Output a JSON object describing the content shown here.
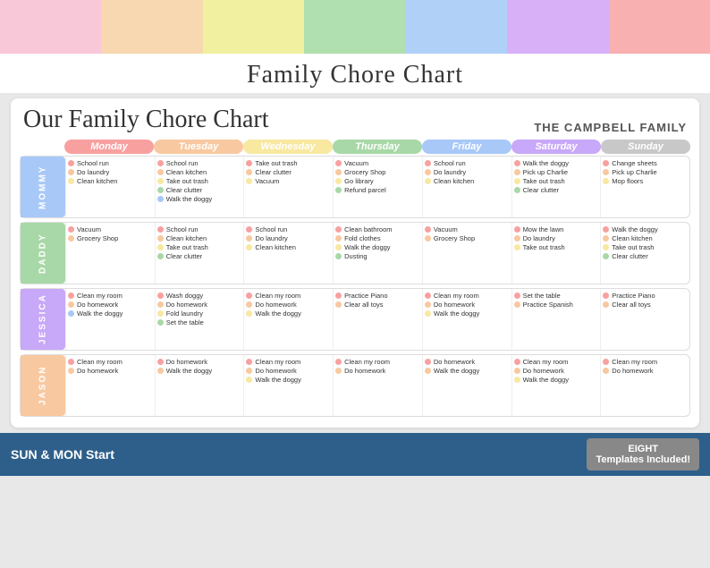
{
  "topBars": [
    {
      "color": "#f8c8d8"
    },
    {
      "color": "#f8d8b0"
    },
    {
      "color": "#f0f0a0"
    },
    {
      "color": "#b0e0b0"
    },
    {
      "color": "#b0d0f8"
    },
    {
      "color": "#d8b0f8"
    },
    {
      "color": "#f8b0b0"
    }
  ],
  "pageTitle": "Family Chore Chart",
  "chartTitle": "Our Family Chore Chart",
  "familyName": "THE CAMPBELL FAMILY",
  "days": [
    "Monday",
    "Tuesday",
    "Wednesday",
    "Thursday",
    "Friday",
    "Saturday",
    "Sunday"
  ],
  "dayColors": [
    "#f8a0a0",
    "#f8c8a0",
    "#f8e8a0",
    "#a8d8a8",
    "#a8c8f8",
    "#c8a8f8",
    "#c8c8c8"
  ],
  "persons": [
    {
      "name": "MOMMY",
      "color": "#a8c8f8",
      "chores": [
        [
          {
            "text": "School run",
            "dotColor": "#f8a0a0"
          },
          {
            "text": "Do laundry",
            "dotColor": "#f8c8a0"
          },
          {
            "text": "Clean kitchen",
            "dotColor": "#f8e8a0"
          }
        ],
        [
          {
            "text": "School run",
            "dotColor": "#f8a0a0"
          },
          {
            "text": "Clean kitchen",
            "dotColor": "#f8c8a0"
          },
          {
            "text": "Take out trash",
            "dotColor": "#f8e8a0"
          },
          {
            "text": "Clear clutter",
            "dotColor": "#a8d8a8"
          },
          {
            "text": "Walk the doggy",
            "dotColor": "#a8c8f8"
          }
        ],
        [
          {
            "text": "Take out trash",
            "dotColor": "#f8a0a0"
          },
          {
            "text": "Clear clutter",
            "dotColor": "#f8c8a0"
          },
          {
            "text": "Vacuum",
            "dotColor": "#f8e8a0"
          }
        ],
        [
          {
            "text": "Vacuum",
            "dotColor": "#f8a0a0"
          },
          {
            "text": "Grocery Shop",
            "dotColor": "#f8c8a0"
          },
          {
            "text": "Go library",
            "dotColor": "#f8e8a0"
          },
          {
            "text": "Refund parcel",
            "dotColor": "#a8d8a8"
          }
        ],
        [
          {
            "text": "School run",
            "dotColor": "#f8a0a0"
          },
          {
            "text": "Do laundry",
            "dotColor": "#f8c8a0"
          },
          {
            "text": "Clean kitchen",
            "dotColor": "#f8e8a0"
          }
        ],
        [
          {
            "text": "Walk the doggy",
            "dotColor": "#f8a0a0"
          },
          {
            "text": "Pick up Charlie",
            "dotColor": "#f8c8a0"
          },
          {
            "text": "Take out trash",
            "dotColor": "#f8e8a0"
          },
          {
            "text": "Clear clutter",
            "dotColor": "#a8d8a8"
          }
        ],
        [
          {
            "text": "Change sheets",
            "dotColor": "#f8a0a0"
          },
          {
            "text": "Pick up Charlie",
            "dotColor": "#f8c8a0"
          },
          {
            "text": "Mop floors",
            "dotColor": "#f8e8a0"
          }
        ]
      ]
    },
    {
      "name": "DADDY",
      "color": "#a8d8a8",
      "chores": [
        [
          {
            "text": "Vacuum",
            "dotColor": "#f8a0a0"
          },
          {
            "text": "Grocery Shop",
            "dotColor": "#f8c8a0"
          }
        ],
        [
          {
            "text": "School run",
            "dotColor": "#f8a0a0"
          },
          {
            "text": "Clean kitchen",
            "dotColor": "#f8c8a0"
          },
          {
            "text": "Take out trash",
            "dotColor": "#f8e8a0"
          },
          {
            "text": "Clear clutter",
            "dotColor": "#a8d8a8"
          }
        ],
        [
          {
            "text": "School run",
            "dotColor": "#f8a0a0"
          },
          {
            "text": "Do laundry",
            "dotColor": "#f8c8a0"
          },
          {
            "text": "Clean kitchen",
            "dotColor": "#f8e8a0"
          }
        ],
        [
          {
            "text": "Clean bathroom",
            "dotColor": "#f8a0a0"
          },
          {
            "text": "Fold clothes",
            "dotColor": "#f8c8a0"
          },
          {
            "text": "Walk the doggy",
            "dotColor": "#f8e8a0"
          },
          {
            "text": "Dusting",
            "dotColor": "#a8d8a8"
          }
        ],
        [
          {
            "text": "Vacuum",
            "dotColor": "#f8a0a0"
          },
          {
            "text": "Grocery Shop",
            "dotColor": "#f8c8a0"
          }
        ],
        [
          {
            "text": "Mow the lawn",
            "dotColor": "#f8a0a0"
          },
          {
            "text": "Do laundry",
            "dotColor": "#f8c8a0"
          },
          {
            "text": "Take out trash",
            "dotColor": "#f8e8a0"
          }
        ],
        [
          {
            "text": "Walk the doggy",
            "dotColor": "#f8a0a0"
          },
          {
            "text": "Clean kitchen",
            "dotColor": "#f8c8a0"
          },
          {
            "text": "Take out trash",
            "dotColor": "#f8e8a0"
          },
          {
            "text": "Clear clutter",
            "dotColor": "#a8d8a8"
          }
        ]
      ]
    },
    {
      "name": "JESSICA",
      "color": "#c8a8f8",
      "chores": [
        [
          {
            "text": "Clean my room",
            "dotColor": "#f8a0a0"
          },
          {
            "text": "Do homework",
            "dotColor": "#f8c8a0"
          },
          {
            "text": "Walk the doggy",
            "dotColor": "#a8c8f8"
          }
        ],
        [
          {
            "text": "Wash doggy",
            "dotColor": "#f8a0a0"
          },
          {
            "text": "Do homework",
            "dotColor": "#f8c8a0"
          },
          {
            "text": "Fold laundry",
            "dotColor": "#f8e8a0"
          },
          {
            "text": "Set the table",
            "dotColor": "#a8d8a8"
          }
        ],
        [
          {
            "text": "Clean my room",
            "dotColor": "#f8a0a0"
          },
          {
            "text": "Do homework",
            "dotColor": "#f8c8a0"
          },
          {
            "text": "Walk the doggy",
            "dotColor": "#f8e8a0"
          }
        ],
        [
          {
            "text": "Practice Piano",
            "dotColor": "#f8a0a0"
          },
          {
            "text": "Clear all toys",
            "dotColor": "#f8c8a0"
          }
        ],
        [
          {
            "text": "Clean my room",
            "dotColor": "#f8a0a0"
          },
          {
            "text": "Do homework",
            "dotColor": "#f8c8a0"
          },
          {
            "text": "Walk the doggy",
            "dotColor": "#f8e8a0"
          }
        ],
        [
          {
            "text": "Set the table",
            "dotColor": "#f8a0a0"
          },
          {
            "text": "Practice Spanish",
            "dotColor": "#f8c8a0"
          }
        ],
        [
          {
            "text": "Practice Piano",
            "dotColor": "#f8a0a0"
          },
          {
            "text": "Clear all toys",
            "dotColor": "#f8c8a0"
          }
        ]
      ]
    },
    {
      "name": "JASON",
      "color": "#f8c8a0",
      "chores": [
        [
          {
            "text": "Clean my room",
            "dotColor": "#f8a0a0"
          },
          {
            "text": "Do homework",
            "dotColor": "#f8c8a0"
          }
        ],
        [
          {
            "text": "Do homework",
            "dotColor": "#f8a0a0"
          },
          {
            "text": "Walk the doggy",
            "dotColor": "#f8c8a0"
          }
        ],
        [
          {
            "text": "Clean my room",
            "dotColor": "#f8a0a0"
          },
          {
            "text": "Do homework",
            "dotColor": "#f8c8a0"
          },
          {
            "text": "Walk the doggy",
            "dotColor": "#f8e8a0"
          }
        ],
        [
          {
            "text": "Clean my room",
            "dotColor": "#f8a0a0"
          },
          {
            "text": "Do homework",
            "dotColor": "#f8c8a0"
          }
        ],
        [
          {
            "text": "Do homework",
            "dotColor": "#f8a0a0"
          },
          {
            "text": "Walk the doggy",
            "dotColor": "#f8c8a0"
          }
        ],
        [
          {
            "text": "Clean my room",
            "dotColor": "#f8a0a0"
          },
          {
            "text": "Do homework",
            "dotColor": "#f8c8a0"
          },
          {
            "text": "Walk the doggy",
            "dotColor": "#f8e8a0"
          }
        ],
        [
          {
            "text": "Clean my room",
            "dotColor": "#f8a0a0"
          },
          {
            "text": "Do homework",
            "dotColor": "#f8c8a0"
          }
        ]
      ]
    }
  ],
  "bottomLeft": "SUN & MON Start",
  "bottomRight": "EIGHT\nTemplates\nIncluded!"
}
